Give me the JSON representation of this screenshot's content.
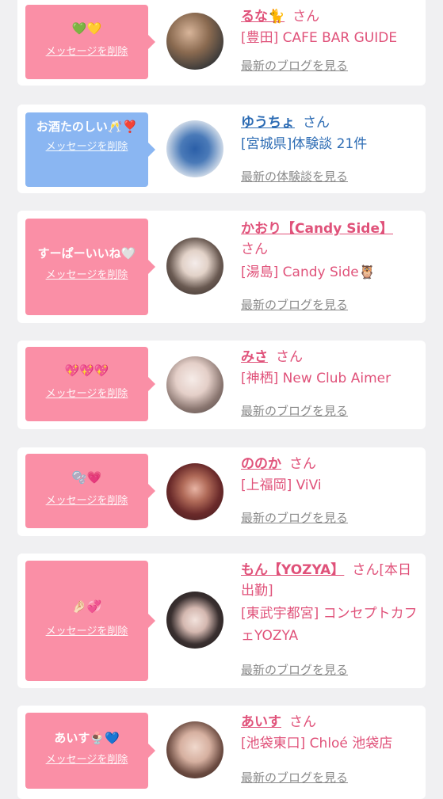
{
  "delete_label": "メッセージを削除",
  "blog_link": "最新のブログを見る",
  "review_link": "最新の体験談を見る",
  "honorific": "さん",
  "items": [
    {
      "message": "💚💛",
      "name": "るな🐈",
      "honorific_line": "さん",
      "shop": "[豊田] CAFE BAR GUIDE",
      "link": "最新のブログを見る",
      "bubble_color": "#fa8fa6"
    },
    {
      "message": "お酒たのしい🥂❣️",
      "name": "ゆうちょ",
      "honorific_line": "さん",
      "shop": "[宮城県]体験談 21件",
      "link": "最新の体験談を見る",
      "bubble_color": "#8ab6f2"
    },
    {
      "message": "すーぱーいいね🤍",
      "name": "かおり【Candy Side】",
      "honorific_line": "さん",
      "shop": "[湯島] Candy Side🦉",
      "link": "最新のブログを見る",
      "bubble_color": "#fa8fa6"
    },
    {
      "message": "💖💖💖",
      "name": "みさ",
      "honorific_line": "さん",
      "shop": "[神栖] New Club Aimer",
      "link": "最新のブログを見る",
      "bubble_color": "#fa8fa6"
    },
    {
      "message": "🫧💗",
      "name": "ののか",
      "honorific_line": "さん",
      "shop": "[上福岡] ViVi",
      "link": "最新のブログを見る",
      "bubble_color": "#fa8fa6"
    },
    {
      "message": "🤌🏻💞",
      "name": "もん【YOZYA】",
      "honorific_line": "さん[本日出勤]",
      "shop": "[東武宇都宮] コンセプトカフェYOZYA",
      "link": "最新のブログを見る",
      "bubble_color": "#fa8fa6"
    },
    {
      "message": "あいす🍨💙",
      "name": "あいす",
      "honorific_line": "さん",
      "shop": "[池袋東口] Chloé 池袋店",
      "link": "最新のブログを見る",
      "bubble_color": "#fa8fa6"
    }
  ],
  "colors": {
    "background": "#f0f0f2",
    "card": "#ffffff",
    "pink_bubble": "#fa8fa6",
    "blue_bubble": "#8ab6f2",
    "pink_text": "#e0527a",
    "blue_text": "#2d6cb4",
    "link_gray": "#8a8a8a"
  }
}
